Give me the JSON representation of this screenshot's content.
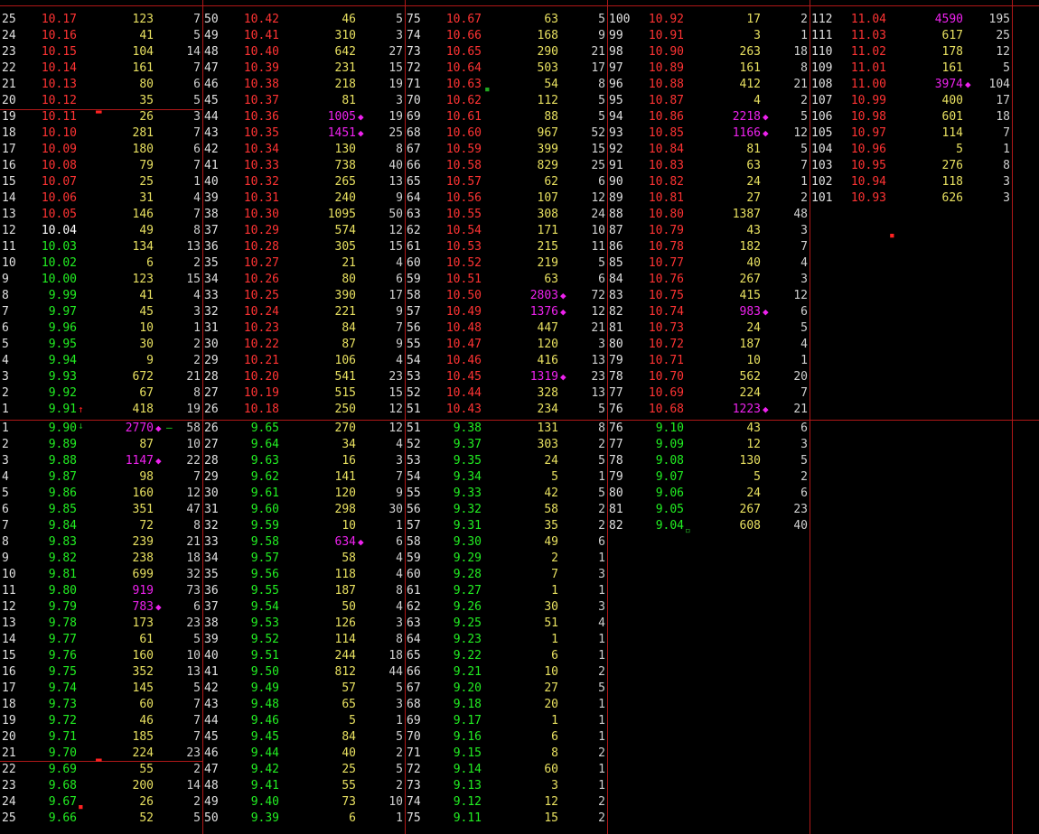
{
  "headers": [
    "",
    "",
    "",
    "",
    "",
    "",
    "",
    "",
    "",
    "",
    "",
    "",
    "",
    "",
    "",
    "",
    "",
    "",
    "",
    "",
    "",
    "",
    "",
    "",
    ""
  ],
  "top_columns": [
    {
      "rows": [
        [
          "25",
          "10.17",
          "123",
          "7"
        ],
        [
          "24",
          "10.16",
          "41",
          "5"
        ],
        [
          "23",
          "10.15",
          "104",
          "14"
        ],
        [
          "22",
          "10.14",
          "161",
          "7"
        ],
        [
          "21",
          "10.13",
          "80",
          "6"
        ],
        [
          "20",
          "10.12",
          "35",
          "5"
        ],
        [
          "19",
          "10.11",
          "26",
          "3"
        ],
        [
          "18",
          "10.10",
          "281",
          "7"
        ],
        [
          "17",
          "10.09",
          "180",
          "6"
        ],
        [
          "16",
          "10.08",
          "79",
          "7"
        ],
        [
          "15",
          "10.07",
          "25",
          "1"
        ],
        [
          "14",
          "10.06",
          "31",
          "4"
        ],
        [
          "13",
          "10.05",
          "146",
          "7"
        ],
        [
          "12",
          "10.04",
          "49",
          "8"
        ],
        [
          "11",
          "10.03",
          "134",
          "13"
        ],
        [
          "10",
          "10.02",
          "6",
          "2"
        ],
        [
          "9",
          "10.00",
          "123",
          "15"
        ],
        [
          "8",
          "9.99",
          "41",
          "4"
        ],
        [
          "7",
          "9.97",
          "45",
          "3"
        ],
        [
          "6",
          "9.96",
          "10",
          "1"
        ],
        [
          "5",
          "9.95",
          "30",
          "2"
        ],
        [
          "4",
          "9.94",
          "9",
          "2"
        ],
        [
          "3",
          "9.93",
          "672",
          "21"
        ],
        [
          "2",
          "9.92",
          "67",
          "8"
        ],
        [
          "1",
          "9.91",
          "418",
          "19"
        ]
      ]
    },
    {
      "rows": [
        [
          "50",
          "10.42",
          "46",
          "5"
        ],
        [
          "49",
          "10.41",
          "310",
          "3"
        ],
        [
          "48",
          "10.40",
          "642",
          "27"
        ],
        [
          "47",
          "10.39",
          "231",
          "15"
        ],
        [
          "46",
          "10.38",
          "218",
          "19"
        ],
        [
          "45",
          "10.37",
          "81",
          "3"
        ],
        [
          "44",
          "10.36",
          "1005",
          "19"
        ],
        [
          "43",
          "10.35",
          "1451",
          "25"
        ],
        [
          "42",
          "10.34",
          "130",
          "8"
        ],
        [
          "41",
          "10.33",
          "738",
          "40"
        ],
        [
          "40",
          "10.32",
          "265",
          "13"
        ],
        [
          "39",
          "10.31",
          "240",
          "9"
        ],
        [
          "38",
          "10.30",
          "1095",
          "50"
        ],
        [
          "37",
          "10.29",
          "574",
          "12"
        ],
        [
          "36",
          "10.28",
          "305",
          "15"
        ],
        [
          "35",
          "10.27",
          "21",
          "4"
        ],
        [
          "34",
          "10.26",
          "80",
          "6"
        ],
        [
          "33",
          "10.25",
          "390",
          "17"
        ],
        [
          "32",
          "10.24",
          "221",
          "9"
        ],
        [
          "31",
          "10.23",
          "84",
          "7"
        ],
        [
          "30",
          "10.22",
          "87",
          "9"
        ],
        [
          "29",
          "10.21",
          "106",
          "4"
        ],
        [
          "28",
          "10.20",
          "541",
          "23"
        ],
        [
          "27",
          "10.19",
          "515",
          "15"
        ],
        [
          "26",
          "10.18",
          "250",
          "12"
        ]
      ]
    },
    {
      "rows": [
        [
          "75",
          "10.67",
          "63",
          "5"
        ],
        [
          "74",
          "10.66",
          "168",
          "9"
        ],
        [
          "73",
          "10.65",
          "290",
          "21"
        ],
        [
          "72",
          "10.64",
          "503",
          "17"
        ],
        [
          "71",
          "10.63",
          "54",
          "8"
        ],
        [
          "70",
          "10.62",
          "112",
          "5"
        ],
        [
          "69",
          "10.61",
          "88",
          "5"
        ],
        [
          "68",
          "10.60",
          "967",
          "52"
        ],
        [
          "67",
          "10.59",
          "399",
          "15"
        ],
        [
          "66",
          "10.58",
          "829",
          "25"
        ],
        [
          "65",
          "10.57",
          "62",
          "6"
        ],
        [
          "64",
          "10.56",
          "107",
          "12"
        ],
        [
          "63",
          "10.55",
          "308",
          "24"
        ],
        [
          "62",
          "10.54",
          "171",
          "10"
        ],
        [
          "61",
          "10.53",
          "215",
          "11"
        ],
        [
          "60",
          "10.52",
          "219",
          "5"
        ],
        [
          "59",
          "10.51",
          "63",
          "6"
        ],
        [
          "58",
          "10.50",
          "2803",
          "72"
        ],
        [
          "57",
          "10.49",
          "1376",
          "12"
        ],
        [
          "56",
          "10.48",
          "447",
          "21"
        ],
        [
          "55",
          "10.47",
          "120",
          "3"
        ],
        [
          "54",
          "10.46",
          "416",
          "13"
        ],
        [
          "53",
          "10.45",
          "1319",
          "23"
        ],
        [
          "52",
          "10.44",
          "328",
          "13"
        ],
        [
          "51",
          "10.43",
          "234",
          "5"
        ]
      ]
    },
    {
      "rows": [
        [
          "100",
          "10.92",
          "17",
          "2"
        ],
        [
          "99",
          "10.91",
          "3",
          "1"
        ],
        [
          "98",
          "10.90",
          "263",
          "18"
        ],
        [
          "97",
          "10.89",
          "161",
          "8"
        ],
        [
          "96",
          "10.88",
          "412",
          "21"
        ],
        [
          "95",
          "10.87",
          "4",
          "2"
        ],
        [
          "94",
          "10.86",
          "2218",
          "5"
        ],
        [
          "93",
          "10.85",
          "1166",
          "12"
        ],
        [
          "92",
          "10.84",
          "81",
          "5"
        ],
        [
          "91",
          "10.83",
          "63",
          "7"
        ],
        [
          "90",
          "10.82",
          "24",
          "1"
        ],
        [
          "89",
          "10.81",
          "27",
          "2"
        ],
        [
          "88",
          "10.80",
          "1387",
          "48"
        ],
        [
          "87",
          "10.79",
          "43",
          "3"
        ],
        [
          "86",
          "10.78",
          "182",
          "7"
        ],
        [
          "85",
          "10.77",
          "40",
          "4"
        ],
        [
          "84",
          "10.76",
          "267",
          "3"
        ],
        [
          "83",
          "10.75",
          "415",
          "12"
        ],
        [
          "82",
          "10.74",
          "983",
          "6"
        ],
        [
          "81",
          "10.73",
          "24",
          "5"
        ],
        [
          "80",
          "10.72",
          "187",
          "4"
        ],
        [
          "79",
          "10.71",
          "10",
          "1"
        ],
        [
          "78",
          "10.70",
          "562",
          "20"
        ],
        [
          "77",
          "10.69",
          "224",
          "7"
        ],
        [
          "76",
          "10.68",
          "1223",
          "21"
        ]
      ]
    },
    {
      "rows": [
        [
          "112",
          "11.04",
          "4590",
          "195"
        ],
        [
          "111",
          "11.03",
          "617",
          "25"
        ],
        [
          "110",
          "11.02",
          "178",
          "12"
        ],
        [
          "109",
          "11.01",
          "161",
          "5"
        ],
        [
          "108",
          "11.00",
          "3974",
          "104"
        ],
        [
          "107",
          "10.99",
          "400",
          "17"
        ],
        [
          "106",
          "10.98",
          "601",
          "18"
        ],
        [
          "105",
          "10.97",
          "114",
          "7"
        ],
        [
          "104",
          "10.96",
          "5",
          "1"
        ],
        [
          "103",
          "10.95",
          "276",
          "8"
        ],
        [
          "102",
          "10.94",
          "118",
          "3"
        ],
        [
          "101",
          "10.93",
          "626",
          "3"
        ]
      ]
    }
  ],
  "bottom_columns": [
    {
      "rows": [
        [
          "1",
          "9.90",
          "2770",
          "58"
        ],
        [
          "2",
          "9.89",
          "87",
          "10"
        ],
        [
          "3",
          "9.88",
          "1147",
          "22"
        ],
        [
          "4",
          "9.87",
          "98",
          "7"
        ],
        [
          "5",
          "9.86",
          "160",
          "12"
        ],
        [
          "6",
          "9.85",
          "351",
          "47"
        ],
        [
          "7",
          "9.84",
          "72",
          "8"
        ],
        [
          "8",
          "9.83",
          "239",
          "21"
        ],
        [
          "9",
          "9.82",
          "238",
          "18"
        ],
        [
          "10",
          "9.81",
          "699",
          "32"
        ],
        [
          "11",
          "9.80",
          "919",
          "73"
        ],
        [
          "12",
          "9.79",
          "783",
          "6"
        ],
        [
          "13",
          "9.78",
          "173",
          "23"
        ],
        [
          "14",
          "9.77",
          "61",
          "5"
        ],
        [
          "15",
          "9.76",
          "160",
          "10"
        ],
        [
          "16",
          "9.75",
          "352",
          "13"
        ],
        [
          "17",
          "9.74",
          "145",
          "5"
        ],
        [
          "18",
          "9.73",
          "60",
          "7"
        ],
        [
          "19",
          "9.72",
          "46",
          "7"
        ],
        [
          "20",
          "9.71",
          "185",
          "7"
        ],
        [
          "21",
          "9.70",
          "224",
          "23"
        ],
        [
          "22",
          "9.69",
          "55",
          "2"
        ],
        [
          "23",
          "9.68",
          "200",
          "14"
        ],
        [
          "24",
          "9.67",
          "26",
          "2"
        ],
        [
          "25",
          "9.66",
          "52",
          "5"
        ]
      ]
    },
    {
      "rows": [
        [
          "26",
          "9.65",
          "270",
          "12"
        ],
        [
          "27",
          "9.64",
          "34",
          "4"
        ],
        [
          "28",
          "9.63",
          "16",
          "3"
        ],
        [
          "29",
          "9.62",
          "141",
          "7"
        ],
        [
          "30",
          "9.61",
          "120",
          "9"
        ],
        [
          "31",
          "9.60",
          "298",
          "30"
        ],
        [
          "32",
          "9.59",
          "10",
          "1"
        ],
        [
          "33",
          "9.58",
          "634",
          "6"
        ],
        [
          "34",
          "9.57",
          "58",
          "4"
        ],
        [
          "35",
          "9.56",
          "118",
          "4"
        ],
        [
          "36",
          "9.55",
          "187",
          "8"
        ],
        [
          "37",
          "9.54",
          "50",
          "4"
        ],
        [
          "38",
          "9.53",
          "126",
          "3"
        ],
        [
          "39",
          "9.52",
          "114",
          "8"
        ],
        [
          "40",
          "9.51",
          "244",
          "18"
        ],
        [
          "41",
          "9.50",
          "812",
          "44"
        ],
        [
          "42",
          "9.49",
          "57",
          "5"
        ],
        [
          "43",
          "9.48",
          "65",
          "3"
        ],
        [
          "44",
          "9.46",
          "5",
          "1"
        ],
        [
          "45",
          "9.45",
          "84",
          "5"
        ],
        [
          "46",
          "9.44",
          "40",
          "2"
        ],
        [
          "47",
          "9.42",
          "25",
          "5"
        ],
        [
          "48",
          "9.41",
          "55",
          "2"
        ],
        [
          "49",
          "9.40",
          "73",
          "10"
        ],
        [
          "50",
          "9.39",
          "6",
          "1"
        ]
      ]
    },
    {
      "rows": [
        [
          "51",
          "9.38",
          "131",
          "8"
        ],
        [
          "52",
          "9.37",
          "303",
          "2"
        ],
        [
          "53",
          "9.35",
          "24",
          "5"
        ],
        [
          "54",
          "9.34",
          "5",
          "1"
        ],
        [
          "55",
          "9.33",
          "42",
          "5"
        ],
        [
          "56",
          "9.32",
          "58",
          "2"
        ],
        [
          "57",
          "9.31",
          "35",
          "2"
        ],
        [
          "58",
          "9.30",
          "49",
          "6"
        ],
        [
          "59",
          "9.29",
          "2",
          "1"
        ],
        [
          "60",
          "9.28",
          "7",
          "3"
        ],
        [
          "61",
          "9.27",
          "1",
          "1"
        ],
        [
          "62",
          "9.26",
          "30",
          "3"
        ],
        [
          "63",
          "9.25",
          "51",
          "4"
        ],
        [
          "64",
          "9.23",
          "1",
          "1"
        ],
        [
          "65",
          "9.22",
          "6",
          "1"
        ],
        [
          "66",
          "9.21",
          "10",
          "2"
        ],
        [
          "67",
          "9.20",
          "27",
          "5"
        ],
        [
          "68",
          "9.18",
          "20",
          "1"
        ],
        [
          "69",
          "9.17",
          "1",
          "1"
        ],
        [
          "70",
          "9.16",
          "6",
          "1"
        ],
        [
          "71",
          "9.15",
          "8",
          "2"
        ],
        [
          "72",
          "9.14",
          "60",
          "1"
        ],
        [
          "73",
          "9.13",
          "3",
          "1"
        ],
        [
          "74",
          "9.12",
          "12",
          "2"
        ],
        [
          "75",
          "9.11",
          "15",
          "2"
        ]
      ]
    },
    {
      "rows": [
        [
          "76",
          "9.10",
          "43",
          "6"
        ],
        [
          "77",
          "9.09",
          "12",
          "3"
        ],
        [
          "78",
          "9.08",
          "130",
          "5"
        ],
        [
          "79",
          "9.07",
          "5",
          "2"
        ],
        [
          "80",
          "9.06",
          "24",
          "6"
        ],
        [
          "81",
          "9.05",
          "267",
          "23"
        ],
        [
          "82",
          "9.04",
          "608",
          "40"
        ]
      ]
    }
  ],
  "colors": {
    "up": "#ff3333",
    "down": "#22ee22",
    "flat": "#ffffff",
    "volume": "#e8e060",
    "large_volume": "#ee22ee",
    "grid": "#b01818"
  }
}
